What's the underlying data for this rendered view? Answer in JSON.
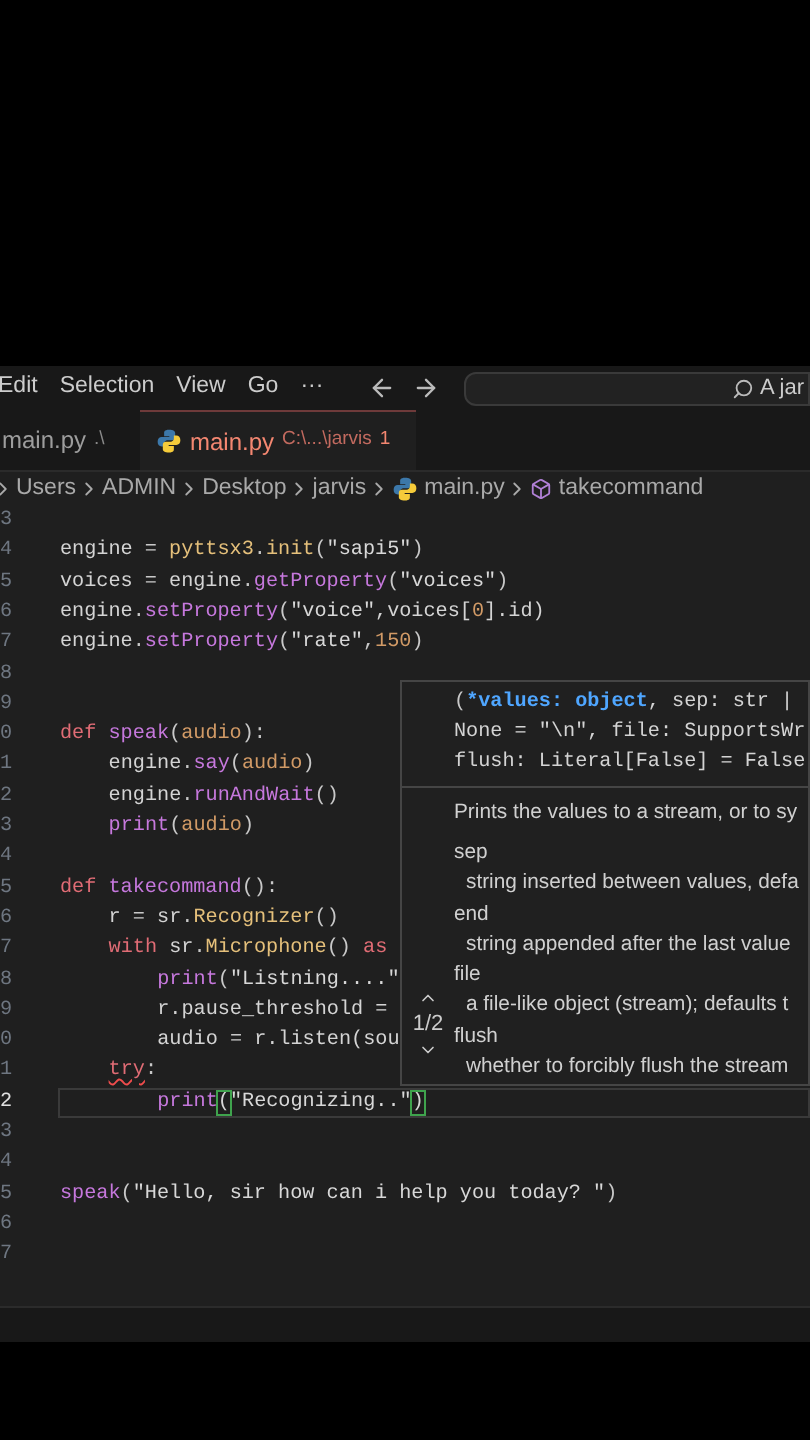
{
  "menu": [
    "Edit",
    "Selection",
    "View",
    "Go",
    "···"
  ],
  "search": {
    "value": "A jar"
  },
  "tabs": [
    {
      "label": "main.py",
      "path": ".\\",
      "selected": false,
      "error": false
    },
    {
      "label": "main.py",
      "path": "C:\\...\\jarvis",
      "problems": "1",
      "selected": true,
      "error": true
    }
  ],
  "breadcrumbs": [
    {
      "text": "Users",
      "kind": "folder"
    },
    {
      "text": "ADMIN",
      "kind": "folder"
    },
    {
      "text": "Desktop",
      "kind": "folder"
    },
    {
      "text": "jarvis",
      "kind": "folder"
    },
    {
      "text": "main.py",
      "kind": "file"
    },
    {
      "text": "takecommand",
      "kind": "symbol"
    }
  ],
  "lines": [
    {
      "number": "3",
      "current": false
    },
    {
      "number": "4",
      "current": false,
      "tokens": [
        {
          "text": "engine",
          "kind": "plain"
        },
        {
          "text": " = ",
          "kind": "op"
        },
        {
          "text": "pyttsx3",
          "kind": "class"
        },
        {
          "text": ".",
          "kind": "op"
        },
        {
          "text": "init",
          "kind": "class"
        },
        {
          "text": "(",
          "kind": "op"
        },
        {
          "text": "\"sapi5\"",
          "kind": "string"
        },
        {
          "text": ")",
          "kind": "op"
        }
      ]
    },
    {
      "number": "5",
      "current": false,
      "tokens": [
        {
          "text": "voices",
          "kind": "plain"
        },
        {
          "text": " = ",
          "kind": "op"
        },
        {
          "text": "engine",
          "kind": "plain"
        },
        {
          "text": ".",
          "kind": "op"
        },
        {
          "text": "getProperty",
          "kind": "func"
        },
        {
          "text": "(",
          "kind": "op"
        },
        {
          "text": "\"voices\"",
          "kind": "string"
        },
        {
          "text": ")",
          "kind": "op"
        }
      ]
    },
    {
      "number": "6",
      "current": false,
      "tokens": [
        {
          "text": "engine",
          "kind": "plain"
        },
        {
          "text": ".",
          "kind": "op"
        },
        {
          "text": "setProperty",
          "kind": "func"
        },
        {
          "text": "(",
          "kind": "op"
        },
        {
          "text": "\"voice\"",
          "kind": "string"
        },
        {
          "text": ",voices[",
          "kind": "plain"
        },
        {
          "text": "0",
          "kind": "number"
        },
        {
          "text": "].id)",
          "kind": "plain"
        }
      ]
    },
    {
      "number": "7",
      "current": false,
      "tokens": [
        {
          "text": "engine",
          "kind": "plain"
        },
        {
          "text": ".",
          "kind": "op"
        },
        {
          "text": "setProperty",
          "kind": "func"
        },
        {
          "text": "(",
          "kind": "op"
        },
        {
          "text": "\"rate\"",
          "kind": "string"
        },
        {
          "text": ",",
          "kind": "op"
        },
        {
          "text": "150",
          "kind": "number"
        },
        {
          "text": ")",
          "kind": "op"
        }
      ]
    },
    {
      "number": "8",
      "current": false
    },
    {
      "number": "9",
      "current": false
    },
    {
      "number": "0",
      "current": false,
      "tokens": [
        {
          "text": "def",
          "kind": "keyword"
        },
        {
          "text": " speak",
          "kind": "func"
        },
        {
          "text": "(",
          "kind": "op"
        },
        {
          "text": "audio",
          "kind": "param"
        },
        {
          "text": "):",
          "kind": "op"
        }
      ],
      "children": [
        {
          "number": "1",
          "current": false,
          "tokens": [
            {
              "text": "engine",
              "kind": "plain"
            },
            {
              "text": ".",
              "kind": "op"
            },
            {
              "text": "say",
              "kind": "func"
            },
            {
              "text": "(",
              "kind": "op"
            },
            {
              "text": "audio",
              "kind": "param"
            },
            {
              "text": ")",
              "kind": "op"
            }
          ]
        },
        {
          "number": "2",
          "current": false,
          "tokens": [
            {
              "text": "engine",
              "kind": "plain"
            },
            {
              "text": ".",
              "kind": "op"
            },
            {
              "text": "runAndWait",
              "kind": "func"
            },
            {
              "text": "()",
              "kind": "op"
            }
          ]
        },
        {
          "number": "3",
          "current": false,
          "tokens": [
            {
              "text": "print",
              "kind": "func"
            },
            {
              "text": "(",
              "kind": "op"
            },
            {
              "text": "audio",
              "kind": "param"
            },
            {
              "text": ")",
              "kind": "op"
            }
          ]
        }
      ]
    },
    {
      "number": "4",
      "current": false
    },
    {
      "number": "5",
      "current": false,
      "tokens": [
        {
          "text": "def",
          "kind": "keyword"
        },
        {
          "text": " takecommand",
          "kind": "func"
        },
        {
          "text": "():",
          "kind": "op"
        }
      ],
      "children": [
        {
          "number": "6",
          "current": false,
          "tokens": [
            {
              "text": "r",
              "kind": "plain"
            },
            {
              "text": " = ",
              "kind": "op"
            },
            {
              "text": "sr",
              "kind": "plain"
            },
            {
              "text": ".",
              "kind": "op"
            },
            {
              "text": "Recognizer",
              "kind": "class"
            },
            {
              "text": "()",
              "kind": "op"
            }
          ]
        },
        {
          "number": "7",
          "current": false,
          "tokens": [
            {
              "text": "with",
              "kind": "keyword"
            },
            {
              "text": " sr",
              "kind": "plain"
            },
            {
              "text": ".",
              "kind": "op"
            },
            {
              "text": "Microphone",
              "kind": "class"
            },
            {
              "text": "() ",
              "kind": "op"
            },
            {
              "text": "as",
              "kind": "keyword"
            }
          ],
          "children": [
            {
              "number": "8",
              "current": false,
              "tokens": [
                {
                  "text": "print",
                  "kind": "func"
                },
                {
                  "text": "(",
                  "kind": "op"
                },
                {
                  "text": "\"Listning....\"",
                  "kind": "string"
                }
              ]
            },
            {
              "number": "9",
              "current": false,
              "tokens": [
                {
                  "text": "r.pause_threshold =",
                  "kind": "plain"
                }
              ]
            },
            {
              "number": "0",
              "current": false,
              "tokens": [
                {
                  "text": "audio",
                  "kind": "plain"
                },
                {
                  "text": " = ",
                  "kind": "op"
                },
                {
                  "text": "r.listen(sou",
                  "kind": "plain"
                }
              ]
            }
          ]
        },
        {
          "number": "1",
          "current": false,
          "tokens": [
            {
              "text": "try",
              "kind": "keyword",
              "error": true
            },
            {
              "text": ":",
              "kind": "op"
            }
          ],
          "children": [
            {
              "number": "2",
              "current": true,
              "tokens": [
                {
                  "text": "print",
                  "kind": "func"
                },
                {
                  "text": "(",
                  "kind": "match"
                },
                {
                  "text": "\"Recognizing..\"",
                  "kind": "string"
                },
                {
                  "text": ")",
                  "kind": "match"
                }
              ]
            }
          ]
        }
      ]
    },
    {
      "number": "3",
      "current": false
    },
    {
      "number": "4",
      "current": false
    },
    {
      "number": "5",
      "current": false,
      "tokens": [
        {
          "text": "speak",
          "kind": "func"
        },
        {
          "text": "(",
          "kind": "op"
        },
        {
          "text": "\"Hello, sir how can i help you today? \"",
          "kind": "string"
        },
        {
          "text": ")",
          "kind": "op"
        }
      ]
    },
    {
      "number": "6",
      "current": false
    },
    {
      "number": "7",
      "current": false
    }
  ],
  "hover": {
    "overload": "1/2",
    "signature": [
      [
        {
          "text": "(",
          "kind": "op"
        },
        {
          "text": "*values: object",
          "kind": "active"
        },
        {
          "text": ", sep: str |",
          "kind": "plain"
        }
      ],
      [
        {
          "text": "None = \"\\n\", file: SupportsWr",
          "kind": "plain"
        }
      ],
      [
        {
          "text": "flush: Literal[False] = False",
          "kind": "plain"
        }
      ]
    ],
    "description": "Prints the values to a stream, or to sy",
    "params": [
      {
        "name": "sep",
        "doc": "string inserted between values, defa"
      },
      {
        "name": "end",
        "doc": "string appended after the last value"
      },
      {
        "name": "file",
        "doc": "a file-like object (stream); defaults t"
      },
      {
        "name": "flush",
        "doc": "whether to forcibly flush the stream"
      }
    ]
  }
}
